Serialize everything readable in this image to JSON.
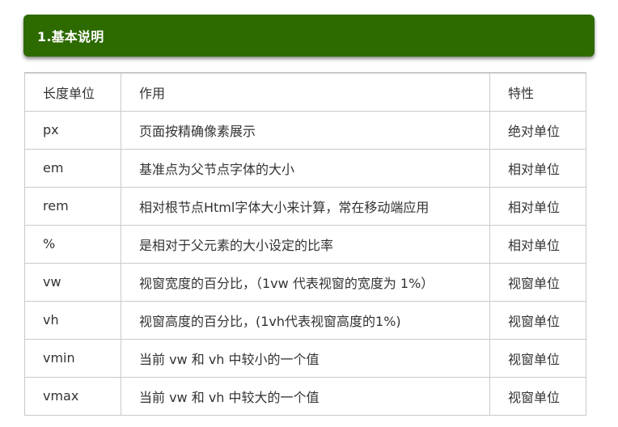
{
  "section": {
    "title": "1.基本说明"
  },
  "table": {
    "headers": [
      "长度单位",
      "作用",
      "特性"
    ],
    "rows": [
      [
        "px",
        "页面按精确像素展示",
        "绝对单位"
      ],
      [
        "em",
        "基准点为父节点字体的大小",
        "相对单位"
      ],
      [
        "rem",
        "相对根节点Html字体大小来计算，常在移动端应用",
        "相对单位"
      ],
      [
        "%",
        "是相对于父元素的大小设定的比率",
        "相对单位"
      ],
      [
        "vw",
        "视窗宽度的百分比，（1vw 代表视窗的宽度为 1%）",
        "视窗单位"
      ],
      [
        "vh",
        "视窗高度的百分比，(1vh代表视窗高度的1%)",
        "视窗单位"
      ],
      [
        "vmin",
        "当前 vw 和 vh 中较小的一个值",
        "视窗单位"
      ],
      [
        "vmax",
        "当前 vw 和 vh 中较大的一个值",
        "视窗单位"
      ]
    ]
  },
  "colors": {
    "header_bg": "#2d6a00",
    "header_text": "#ffffff",
    "table_border": "#c9c9c9",
    "cell_text": "#333333"
  }
}
